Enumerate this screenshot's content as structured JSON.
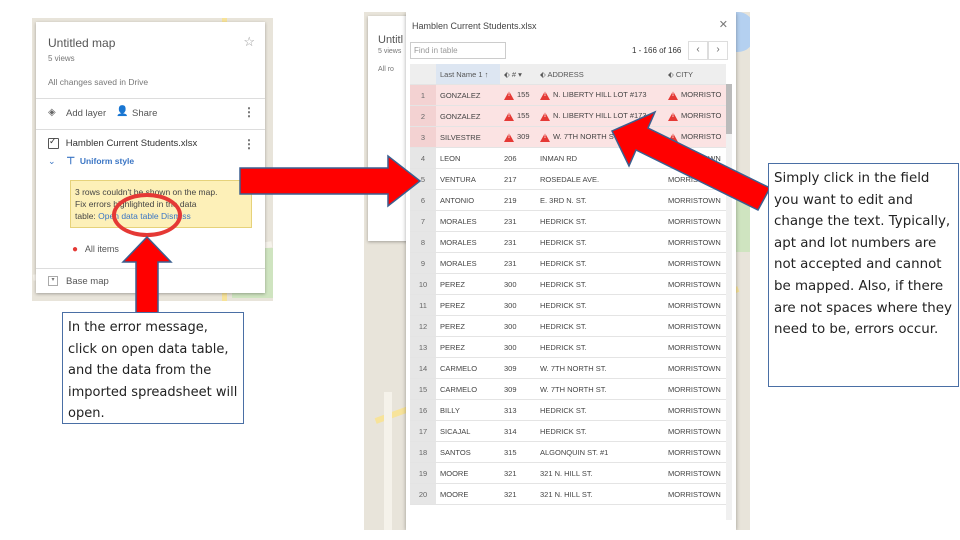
{
  "left_panel": {
    "map_title": "Untitled map",
    "views": "5 views",
    "save_status": "All changes saved in Drive",
    "add_layer": "Add layer",
    "share": "Share",
    "layer_name": "Hamblen Current Students.xlsx",
    "style_label": "Uniform style",
    "error_line1": "3 rows couldn't be shown on the map.",
    "error_line2": "Fix errors highlighted in the data",
    "error_line3_prefix": "table:",
    "open_data_table": "Open data table",
    "dismiss": "Dismiss",
    "all_items": "All items",
    "base_map": "Base map"
  },
  "left_note": "In the error message, click on open data table, and the data from the imported spreadsheet will open.",
  "right_note": "Simply click in the field you want to edit and change the text. Typically, apt and lot numbers are not accepted and cannot be mapped. Also, if there are not spaces where they need to be, errors occur.",
  "bg_panel": {
    "title_partial": "Untitl",
    "views_partial": "5 views",
    "all_partial": "All ro"
  },
  "table": {
    "title": "Hamblen Current Students.xlsx",
    "search_placeholder": "Find in table",
    "pagination": "1 - 166 of 166",
    "columns": [
      "Last Name 1",
      "#",
      "ADDRESS",
      "CITY"
    ],
    "rows": [
      {
        "n": "1",
        "last": "GONZALEZ",
        "num": "155",
        "addr": "N. LIBERTY HILL LOT #173",
        "city": "MORRISTO",
        "err": true
      },
      {
        "n": "2",
        "last": "GONZALEZ",
        "num": "155",
        "addr": "N. LIBERTY HILL LOT #173",
        "city": "MORRISTO",
        "err": true
      },
      {
        "n": "3",
        "last": "SILVESTRE",
        "num": "309",
        "addr": "W. 7TH NORTH ST.",
        "city": "MORRISTO",
        "err": true
      },
      {
        "n": "4",
        "last": "LEON",
        "num": "206",
        "addr": "INMAN RD",
        "city": "MORRISTOWN",
        "err": false
      },
      {
        "n": "5",
        "last": "VENTURA",
        "num": "217",
        "addr": "ROSEDALE AVE.",
        "city": "MORRISTOWN",
        "err": false
      },
      {
        "n": "6",
        "last": "ANTONIO",
        "num": "219",
        "addr": "E. 3RD N. ST.",
        "city": "MORRISTOWN",
        "err": false
      },
      {
        "n": "7",
        "last": "MORALES",
        "num": "231",
        "addr": "HEDRICK ST.",
        "city": "MORRISTOWN",
        "err": false
      },
      {
        "n": "8",
        "last": "MORALES",
        "num": "231",
        "addr": "HEDRICK ST.",
        "city": "MORRISTOWN",
        "err": false
      },
      {
        "n": "9",
        "last": "MORALES",
        "num": "231",
        "addr": "HEDRICK ST.",
        "city": "MORRISTOWN",
        "err": false
      },
      {
        "n": "10",
        "last": "PEREZ",
        "num": "300",
        "addr": "HEDRICK ST.",
        "city": "MORRISTOWN",
        "err": false
      },
      {
        "n": "11",
        "last": "PEREZ",
        "num": "300",
        "addr": "HEDRICK ST.",
        "city": "MORRISTOWN",
        "err": false
      },
      {
        "n": "12",
        "last": "PEREZ",
        "num": "300",
        "addr": "HEDRICK ST.",
        "city": "MORRISTOWN",
        "err": false
      },
      {
        "n": "13",
        "last": "PEREZ",
        "num": "300",
        "addr": "HEDRICK ST.",
        "city": "MORRISTOWN",
        "err": false
      },
      {
        "n": "14",
        "last": "CARMELO",
        "num": "309",
        "addr": "W. 7TH NORTH ST.",
        "city": "MORRISTOWN",
        "err": false
      },
      {
        "n": "15",
        "last": "CARMELO",
        "num": "309",
        "addr": "W. 7TH NORTH ST.",
        "city": "MORRISTOWN",
        "err": false
      },
      {
        "n": "16",
        "last": "BILLY",
        "num": "313",
        "addr": "HEDRICK ST.",
        "city": "MORRISTOWN",
        "err": false
      },
      {
        "n": "17",
        "last": "SICAJAL",
        "num": "314",
        "addr": "HEDRICK ST.",
        "city": "MORRISTOWN",
        "err": false
      },
      {
        "n": "18",
        "last": "SANTOS",
        "num": "315",
        "addr": "ALGONQUIN ST. #1",
        "city": "MORRISTOWN",
        "err": false
      },
      {
        "n": "19",
        "last": "MOORE",
        "num": "321",
        "addr": "321 N. HILL ST.",
        "city": "MORRISTOWN",
        "err": false
      },
      {
        "n": "20",
        "last": "MOORE",
        "num": "321",
        "addr": "321 N. HILL ST.",
        "city": "MORRISTOWN",
        "err": false
      }
    ]
  },
  "colors": {
    "arrow_red": "#ff0000",
    "arrow_outline": "#3b5f8f",
    "error_row": "#fbe3e3",
    "link_blue": "#3a75c4",
    "error_banner": "#fdf0b8"
  }
}
